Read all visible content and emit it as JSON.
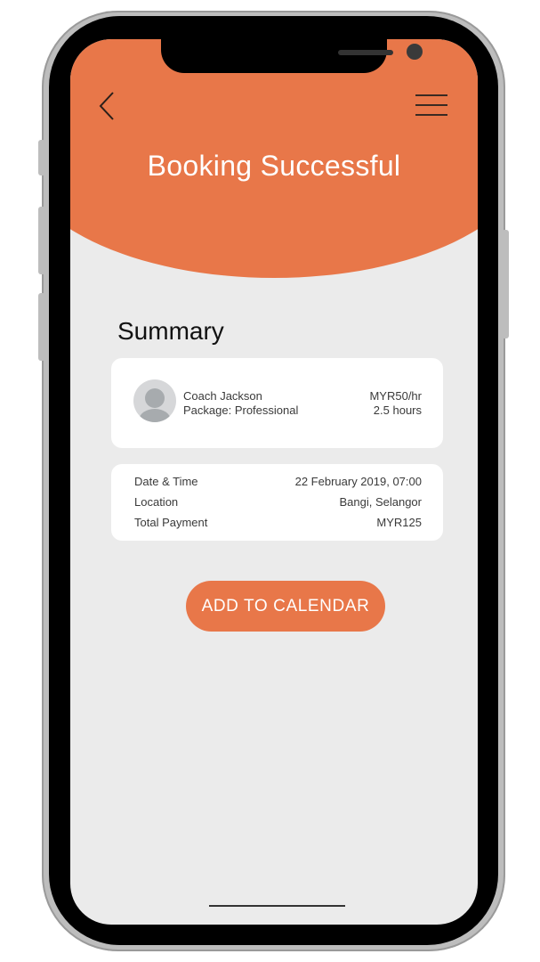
{
  "header": {
    "title": "Booking Successful",
    "accent_color": "#e87749",
    "back_icon": "chevron-left-icon",
    "menu_icon": "hamburger-menu-icon"
  },
  "summary": {
    "heading": "Summary",
    "coach": {
      "avatar_icon": "user-avatar-icon",
      "name": "Coach Jackson",
      "package": "Package: Professional",
      "rate": "MYR50/hr",
      "duration": "2.5 hours"
    },
    "details": [
      {
        "label": "Date & Time",
        "value": "22 February 2019, 07:00"
      },
      {
        "label": "Location",
        "value": "Bangi, Selangor"
      },
      {
        "label": "Total Payment",
        "value": "MYR125"
      }
    ]
  },
  "actions": {
    "add_to_calendar": "ADD TO CALENDAR"
  }
}
